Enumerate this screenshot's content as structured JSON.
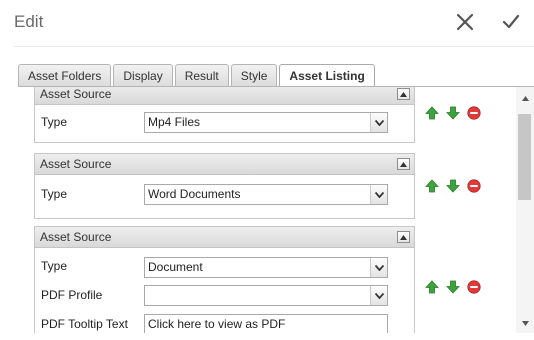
{
  "header": {
    "title": "Edit",
    "close_icon": "close-icon",
    "confirm_icon": "checkmark-icon"
  },
  "tabs": [
    {
      "label": "Asset Folders",
      "active": false
    },
    {
      "label": "Display",
      "active": false
    },
    {
      "label": "Result",
      "active": false
    },
    {
      "label": "Style",
      "active": false
    },
    {
      "label": "Asset Listing",
      "active": true
    }
  ],
  "panels": [
    {
      "title": "Asset Source",
      "fields": [
        {
          "label": "Type",
          "kind": "select",
          "value": "Mp4 Files"
        }
      ]
    },
    {
      "title": "Asset Source",
      "fields": [
        {
          "label": "Type",
          "kind": "select",
          "value": "Word Documents"
        }
      ]
    },
    {
      "title": "Asset Source",
      "fields": [
        {
          "label": "Type",
          "kind": "select",
          "value": "Document"
        },
        {
          "label": "PDF Profile",
          "kind": "select",
          "value": ""
        },
        {
          "label": "PDF Tooltip Text",
          "kind": "text",
          "value": "Click here to view as PDF"
        }
      ]
    }
  ],
  "colors": {
    "move_arrow": "#3da33d",
    "remove": "#e03a3a",
    "accent_text": "#333333"
  }
}
